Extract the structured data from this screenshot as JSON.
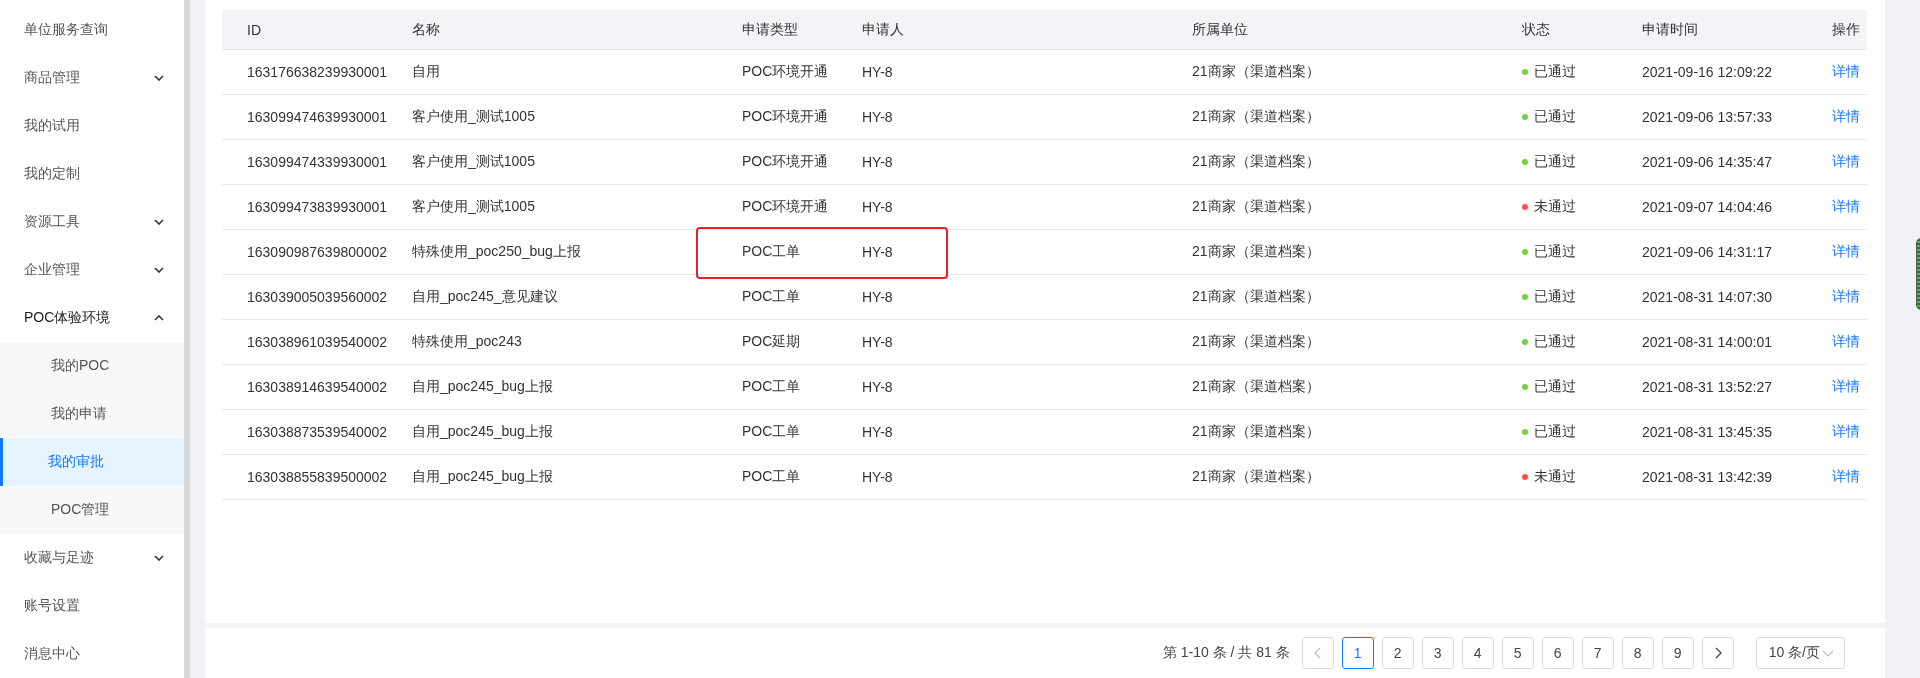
{
  "sidebar": {
    "items": [
      {
        "label": "单位服务查询",
        "selected": false
      },
      {
        "label": "商品管理",
        "expanded": false,
        "selected": false
      },
      {
        "label": "我的试用",
        "selected": false
      },
      {
        "label": "我的定制",
        "selected": false
      },
      {
        "label": "资源工具",
        "expanded": false,
        "selected": false
      },
      {
        "label": "企业管理",
        "expanded": false,
        "selected": false
      },
      {
        "label": "POC体验环境",
        "expanded": true,
        "selected": false,
        "children": [
          {
            "label": "我的POC",
            "selected": false
          },
          {
            "label": "我的申请",
            "selected": false
          },
          {
            "label": "我的审批",
            "selected": true
          },
          {
            "label": "POC管理",
            "selected": false
          }
        ]
      },
      {
        "label": "收藏与足迹",
        "expanded": false,
        "selected": false
      },
      {
        "label": "账号设置",
        "selected": false
      },
      {
        "label": "消息中心",
        "selected": false
      }
    ]
  },
  "table": {
    "columns": [
      "ID",
      "名称",
      "申请类型",
      "申请人",
      "所属单位",
      "状态",
      "申请时间",
      "操作"
    ],
    "rows": [
      {
        "id": "163176638239930001",
        "name": "自用",
        "type": "POC环境开通",
        "applicant": "HY-8",
        "unit": "21商家（渠道档案）",
        "status": "已通过",
        "color": "#73d13d",
        "time": "2021-09-16 12:09:22",
        "action": "详情",
        "highlighted": false
      },
      {
        "id": "163099474639930001",
        "name": "客户使用_测试1005",
        "type": "POC环境开通",
        "applicant": "HY-8",
        "unit": "21商家（渠道档案）",
        "status": "已通过",
        "color": "#73d13d",
        "time": "2021-09-06 13:57:33",
        "action": "详情",
        "highlighted": false
      },
      {
        "id": "163099474339930001",
        "name": "客户使用_测试1005",
        "type": "POC环境开通",
        "applicant": "HY-8",
        "unit": "21商家（渠道档案）",
        "status": "已通过",
        "color": "#73d13d",
        "time": "2021-09-06 14:35:47",
        "action": "详情",
        "highlighted": false
      },
      {
        "id": "163099473839930001",
        "name": "客户使用_测试1005",
        "type": "POC环境开通",
        "applicant": "HY-8",
        "unit": "21商家（渠道档案）",
        "status": "未通过",
        "color": "#ff4d4f",
        "time": "2021-09-07 14:04:46",
        "action": "详情",
        "highlighted": false
      },
      {
        "id": "163090987639800002",
        "name": "特殊使用_poc250_bug上报",
        "type": "POC工单",
        "applicant": "HY-8",
        "unit": "21商家（渠道档案）",
        "status": "已通过",
        "color": "#73d13d",
        "time": "2021-09-06 14:31:17",
        "action": "详情",
        "highlighted": true
      },
      {
        "id": "163039005039560002",
        "name": "自用_poc245_意见建议",
        "type": "POC工单",
        "applicant": "HY-8",
        "unit": "21商家（渠道档案）",
        "status": "已通过",
        "color": "#73d13d",
        "time": "2021-08-31 14:07:30",
        "action": "详情",
        "highlighted": false
      },
      {
        "id": "163038961039540002",
        "name": "特殊使用_poc243",
        "type": "POC延期",
        "applicant": "HY-8",
        "unit": "21商家（渠道档案）",
        "status": "已通过",
        "color": "#73d13d",
        "time": "2021-08-31 14:00:01",
        "action": "详情",
        "highlighted": false
      },
      {
        "id": "163038914639540002",
        "name": "自用_poc245_bug上报",
        "type": "POC工单",
        "applicant": "HY-8",
        "unit": "21商家（渠道档案）",
        "status": "已通过",
        "color": "#73d13d",
        "time": "2021-08-31 13:52:27",
        "action": "详情",
        "highlighted": false
      },
      {
        "id": "163038873539540002",
        "name": "自用_poc245_bug上报",
        "type": "POC工单",
        "applicant": "HY-8",
        "unit": "21商家（渠道档案）",
        "status": "已通过",
        "color": "#73d13d",
        "time": "2021-08-31 13:45:35",
        "action": "详情",
        "highlighted": false
      },
      {
        "id": "163038855839500002",
        "name": "自用_poc245_bug上报",
        "type": "POC工单",
        "applicant": "HY-8",
        "unit": "21商家（渠道档案）",
        "status": "未通过",
        "color": "#ff4d4f",
        "time": "2021-08-31 13:42:39",
        "action": "详情",
        "highlighted": false
      }
    ]
  },
  "pagination": {
    "summary": "第 1-10 条 / 共 81 条",
    "prev_disabled": true,
    "pages": [
      {
        "label": "1",
        "selected": true
      },
      {
        "label": "2",
        "selected": false
      },
      {
        "label": "3",
        "selected": false
      },
      {
        "label": "4",
        "selected": false
      },
      {
        "label": "5",
        "selected": false
      },
      {
        "label": "6",
        "selected": false
      },
      {
        "label": "7",
        "selected": false
      },
      {
        "label": "8",
        "selected": false
      },
      {
        "label": "9",
        "selected": false
      }
    ],
    "next_disabled": false,
    "page_size": "10 条/页"
  }
}
